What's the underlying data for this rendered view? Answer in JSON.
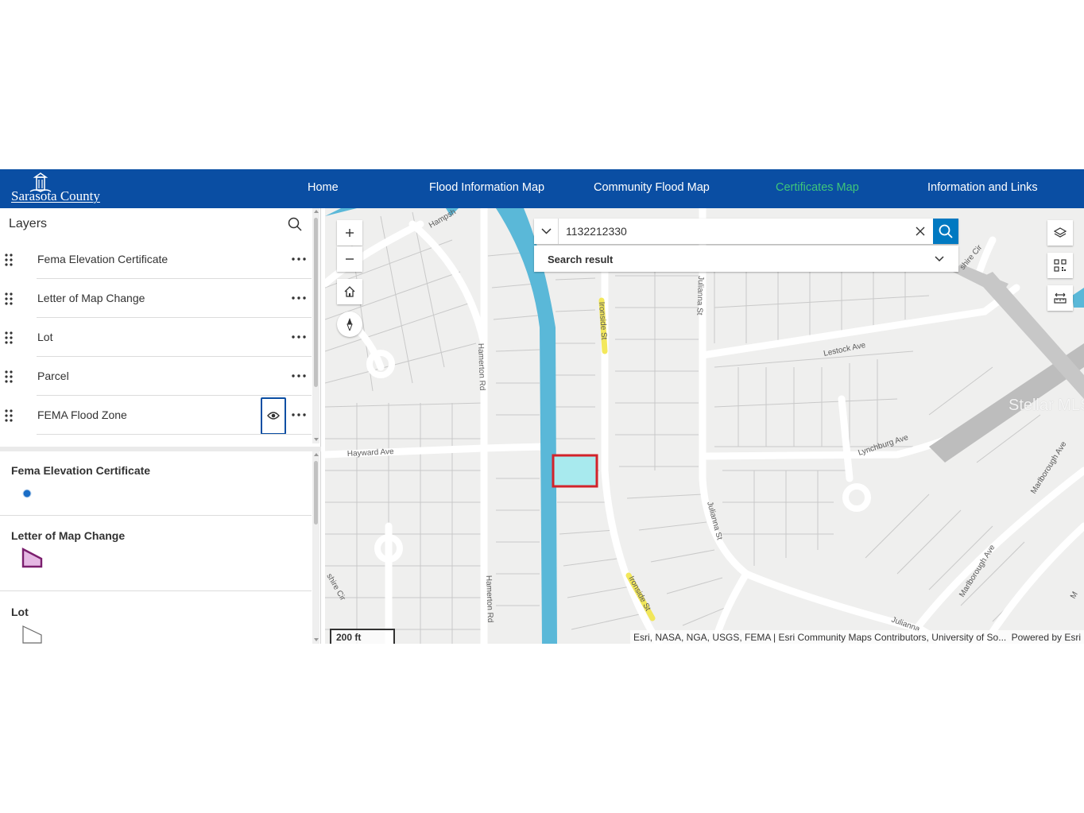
{
  "header": {
    "logo_text": "Sarasota County",
    "nav": [
      {
        "label": "Home",
        "active": false
      },
      {
        "label": "Flood Information Map",
        "active": false
      },
      {
        "label": "Community Flood Map",
        "active": false
      },
      {
        "label": "Certificates Map",
        "active": true
      },
      {
        "label": "Information and Links",
        "active": false
      }
    ],
    "bg_color": "#0a4ea3",
    "active_color": "#3fc57a"
  },
  "layers_panel": {
    "title": "Layers",
    "items": [
      {
        "label": "Fema Elevation Certificate",
        "icon": "more-icon"
      },
      {
        "label": "Letter of Map Change",
        "icon": "more-icon"
      },
      {
        "label": "Lot",
        "icon": "more-icon"
      },
      {
        "label": "Parcel",
        "icon": "more-icon"
      },
      {
        "label": "FEMA Flood Zone",
        "icon": "more-icon",
        "visibility_icon": "eye-icon"
      }
    ]
  },
  "legend": {
    "sections": [
      {
        "title": "Fema Elevation Certificate",
        "symbol": "blue-dot-icon",
        "color": "#1a6dc6"
      },
      {
        "title": "Letter of Map Change",
        "symbol": "pink-polygon-icon",
        "color": "#e5b8e3"
      },
      {
        "title": "Lot",
        "symbol": "outline-polygon-icon",
        "color": "#ffffff"
      }
    ]
  },
  "map": {
    "search": {
      "value": "1132212330",
      "result_label": "Search result"
    },
    "street_labels": {
      "hampshire": "Hampsh",
      "hamerton_top": "Hamerton Rd",
      "hamerton_bottom": "Hamerton Rd",
      "hayward": "Hayward Ave",
      "ironside_top": "Ironside St",
      "ironside_bottom": "Ironside St",
      "julianna_top": "Julianna St",
      "julianna_mid": "Julianna St",
      "julianna_bottom": "Julianna",
      "lestock": "Lestock Ave",
      "lynchburg": "Lynchburg Ave",
      "marlborough_right": "Marlborough Ave",
      "marlborough_left": "Marlborough Ave",
      "shire_cir_top": "shire Cir",
      "shire_cir_left": "shire Cir",
      "m_edge": "M"
    },
    "scale_label": "200 ft",
    "attribution": "Esri, NASA, NGA, USGS, FEMA | Esri Community Maps Contributors, University of So...",
    "powered_by": "Powered by Esri",
    "watermark": "Stellar MLS",
    "canal_color": "#5ab8d8",
    "highlight_fill": "#a8eaee",
    "highlight_border": "#d2232a",
    "label_highlight": "#f2e64a"
  }
}
